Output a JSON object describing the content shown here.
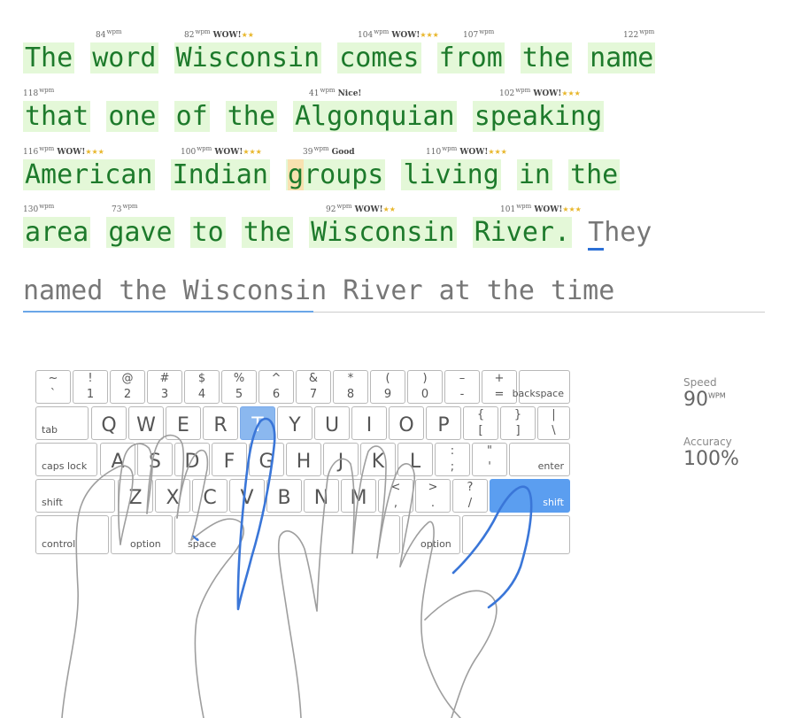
{
  "typing": {
    "lines": [
      {
        "wpm": [
          {
            "value": "84",
            "unit": "wpm",
            "tag": "",
            "stars": ""
          },
          {
            "value": "82",
            "unit": "wpm",
            "tag": "WOW!",
            "stars": "★★"
          },
          {
            "value": "104",
            "unit": "wpm",
            "tag": "WOW!",
            "stars": "★★★"
          },
          {
            "value": "107",
            "unit": "wpm",
            "tag": "",
            "stars": ""
          },
          {
            "value": "122",
            "unit": "wpm",
            "tag": "",
            "stars": ""
          }
        ],
        "words": [
          "The",
          "word",
          "Wisconsin",
          "comes",
          "from",
          "the",
          "name"
        ]
      },
      {
        "wpm": [
          {
            "value": "118",
            "unit": "wpm",
            "tag": "",
            "stars": ""
          },
          {
            "value": "41",
            "unit": "wpm",
            "tag": "Nice!",
            "stars": ""
          },
          {
            "value": "102",
            "unit": "wpm",
            "tag": "WOW!",
            "stars": "★★★"
          }
        ],
        "words": [
          "that",
          "one",
          "of",
          "the",
          "Algonquian",
          "speaking"
        ]
      },
      {
        "wpm": [
          {
            "value": "116",
            "unit": "wpm",
            "tag": "WOW!",
            "stars": "★★★"
          },
          {
            "value": "100",
            "unit": "wpm",
            "tag": "WOW!",
            "stars": "★★★"
          },
          {
            "value": "39",
            "unit": "wpm",
            "tag": "Good",
            "stars": ""
          },
          {
            "value": "110",
            "unit": "wpm",
            "tag": "WOW!",
            "stars": "★★★"
          }
        ],
        "words": [
          "American",
          "Indian",
          "groups",
          "living",
          "in",
          "the"
        ]
      },
      {
        "wpm": [
          {
            "value": "130",
            "unit": "wpm",
            "tag": "",
            "stars": ""
          },
          {
            "value": "73",
            "unit": "wpm",
            "tag": "",
            "stars": ""
          },
          {
            "value": "92",
            "unit": "wpm",
            "tag": "WOW!",
            "stars": "★★"
          },
          {
            "value": "101",
            "unit": "wpm",
            "tag": "WOW!",
            "stars": "★★★"
          }
        ],
        "words": [
          "area",
          "gave",
          "to",
          "the",
          "Wisconsin",
          "River."
        ],
        "current_word": "They"
      }
    ],
    "pending_line": "named the Wisconsin River at the time"
  },
  "keyboard": {
    "row1": [
      [
        "~",
        "`"
      ],
      [
        "!",
        "1"
      ],
      [
        "@",
        "2"
      ],
      [
        "#",
        "3"
      ],
      [
        "$",
        "4"
      ],
      [
        "%",
        "5"
      ],
      [
        "^",
        "6"
      ],
      [
        "&",
        "7"
      ],
      [
        "*",
        "8"
      ],
      [
        "(",
        "9"
      ],
      [
        ")",
        "0"
      ],
      [
        "–",
        "-"
      ],
      [
        "+",
        "="
      ]
    ],
    "backspace": "backspace",
    "tab": "tab",
    "row2": [
      "Q",
      "W",
      "E",
      "R",
      "T",
      "Y",
      "U",
      "I",
      "O",
      "P"
    ],
    "row2_sym": [
      [
        "{",
        "["
      ],
      [
        "}",
        "]"
      ],
      [
        "|",
        "\\"
      ]
    ],
    "caps": "caps lock",
    "row3": [
      "A",
      "S",
      "D",
      "F",
      "G",
      "H",
      "J",
      "K",
      "L"
    ],
    "row3_sym": [
      [
        ":",
        ";"
      ],
      [
        "\"",
        "'"
      ]
    ],
    "enter": "enter",
    "shift_left": "shift",
    "row4": [
      "Z",
      "X",
      "C",
      "V",
      "B",
      "N",
      "M"
    ],
    "row4_sym": [
      [
        "<",
        ","
      ],
      [
        ">",
        "."
      ],
      [
        "?",
        "/"
      ]
    ],
    "shift_right": "shift",
    "control": "control",
    "option_left": "option",
    "space": "space",
    "option_right": "option",
    "active_key": "T",
    "accent": "#8bb8ef"
  },
  "stats": {
    "speed_label": "Speed",
    "speed_value": "90",
    "speed_unit": "WPM",
    "accuracy_label": "Accuracy",
    "accuracy_value": "100%"
  }
}
